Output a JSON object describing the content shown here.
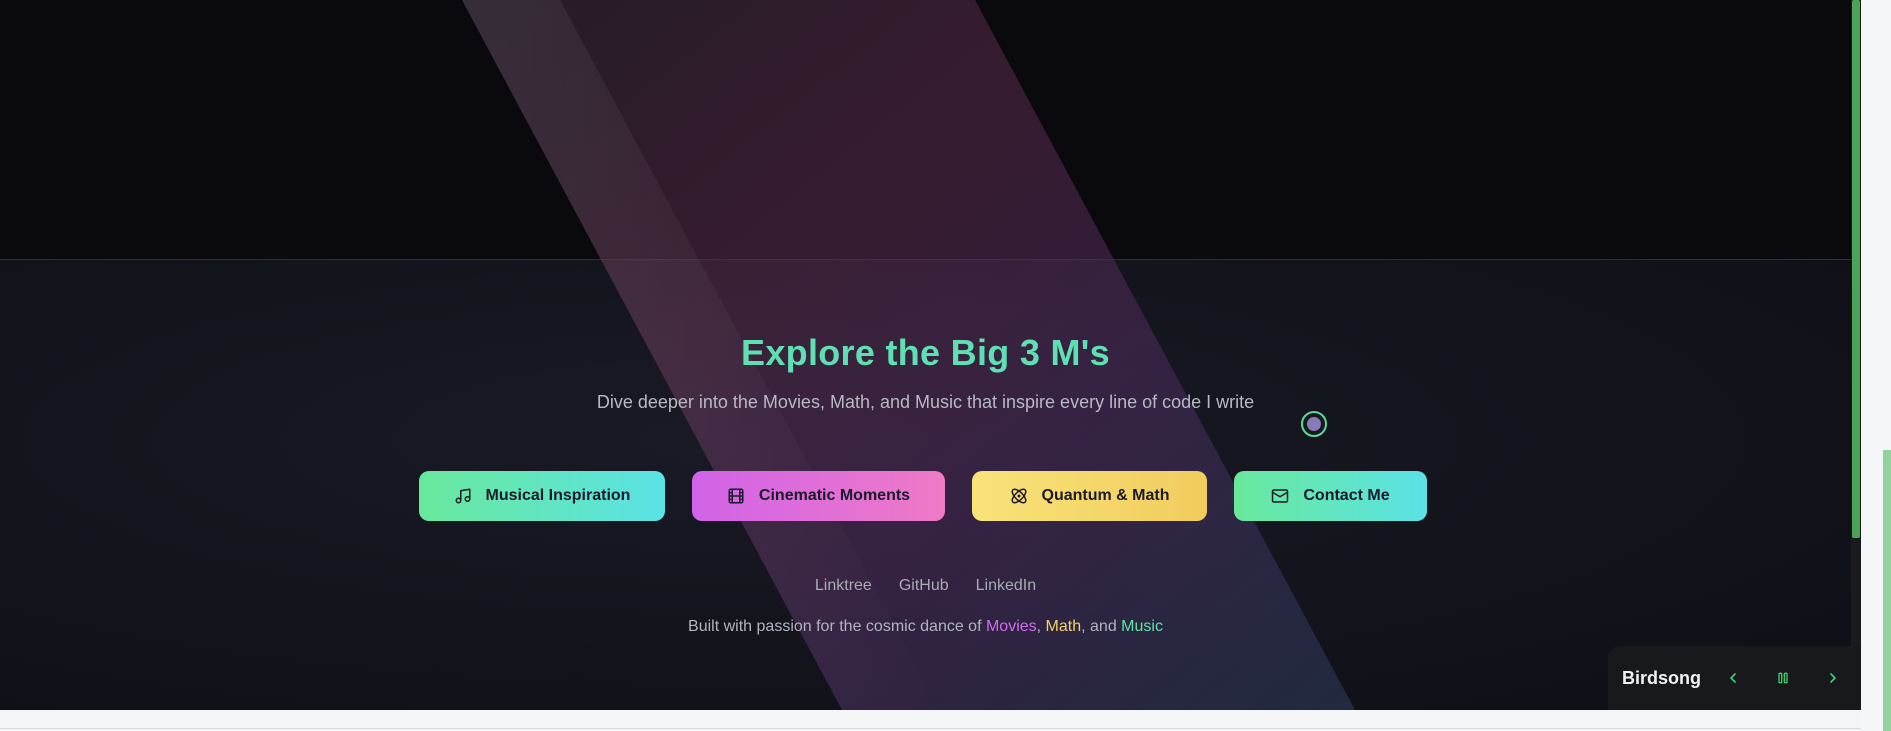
{
  "footer": {
    "title": "Explore the Big 3 M's",
    "subtitle": "Dive deeper into the Movies, Math, and Music that inspire every line of code I write",
    "buttons": {
      "music": {
        "label": "Musical Inspiration",
        "icon": "music-note-icon"
      },
      "movies": {
        "label": "Cinematic Moments",
        "icon": "film-icon"
      },
      "math": {
        "label": "Quantum & Math",
        "icon": "atom-icon"
      },
      "contact": {
        "label": "Contact Me",
        "icon": "mail-icon"
      }
    },
    "links": {
      "linktree": "Linktree",
      "github": "GitHub",
      "linkedin": "LinkedIn"
    },
    "credit": {
      "prefix": "Built with passion for the cosmic dance of ",
      "movies": "Movies",
      "sep1": ", ",
      "math": "Math",
      "sep2": ", and ",
      "music": "Music"
    }
  },
  "player": {
    "track": "Birdsong",
    "prev_icon": "chevron-left-icon",
    "pause_icon": "pause-icon",
    "next_icon": "chevron-right-icon"
  },
  "colors": {
    "accent_green": "#5fe0b3",
    "movies_purple": "#cf6df0",
    "math_yellow": "#f3d26a",
    "music_green": "#63e2a6",
    "background": "#0b0b10"
  }
}
